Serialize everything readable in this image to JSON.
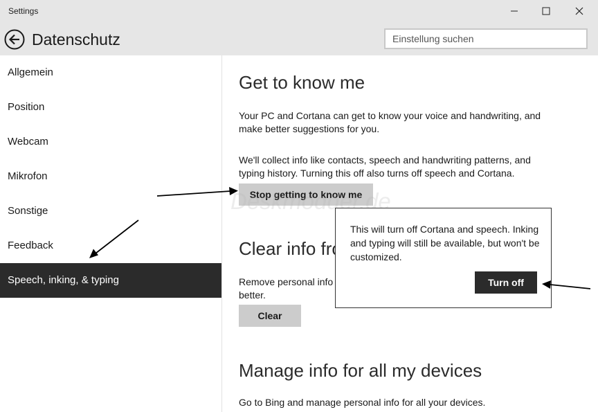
{
  "window": {
    "title": "Settings",
    "controls": {
      "minimize": "—",
      "maximize": "☐",
      "close": "✕"
    }
  },
  "header": {
    "title": "Datenschutz",
    "search_placeholder": "Einstellung suchen"
  },
  "sidebar": {
    "items": [
      {
        "label": "Allgemein"
      },
      {
        "label": "Position"
      },
      {
        "label": "Webcam"
      },
      {
        "label": "Mikrofon"
      },
      {
        "label": "Sonstige"
      },
      {
        "label": "Feedback"
      },
      {
        "label": "Speech, inking, & typing",
        "selected": true
      }
    ]
  },
  "main": {
    "get_to_know": {
      "heading": "Get to know me",
      "para1": "Your PC and Cortana can get to know your voice and handwriting, and make better suggestions for you.",
      "para2": "We'll collect info like contacts, speech and handwriting patterns, and typing history. Turning this off also turns off speech and Cortana.",
      "button": "Stop getting to know me"
    },
    "clear_info": {
      "heading": "Clear info fro",
      "para": "Remove personal info",
      "para_cont": "better.",
      "button": "Clear"
    },
    "manage": {
      "heading": "Manage info for all my devices",
      "para": "Go to Bing and manage personal info for all your devices."
    }
  },
  "flyout": {
    "text": "This will turn off Cortana and speech. Inking and typing will still be available, but won't be customized.",
    "button": "Turn off"
  },
  "watermark": "Deskmodder.de",
  "colors": {
    "selected_bg": "#2b2b2b",
    "header_bg": "#e6e6e6",
    "button_gray": "#cccccc"
  }
}
